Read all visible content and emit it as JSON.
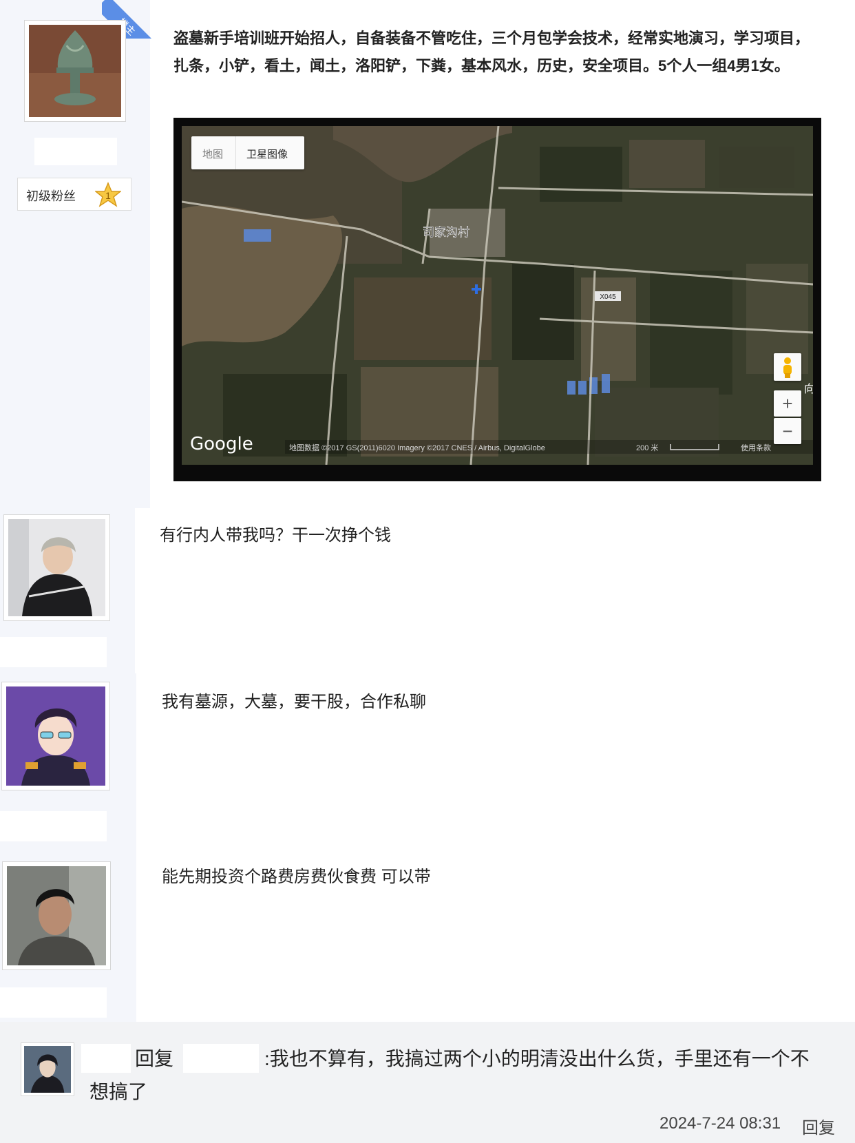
{
  "op_post": {
    "op_tag": "楼主",
    "rank_label": "初级粉丝",
    "rank_level": "1",
    "text": "盗墓新手培训班开始招人，自备装备不管吃住，三个月包学会技术，经常实地演习，学习项目，扎条，小铲，看土，闻土，洛阳铲，下粪，基本风水，历史，安全项目。5个人一组4男1女。",
    "map": {
      "tab_map": "地图",
      "tab_satellite": "卫星图像",
      "village": "司家沟村",
      "road": "X045",
      "zoom_in": "+",
      "zoom_out": "−",
      "side_char": "向",
      "logo": "Google",
      "attribution": "地图数据 ©2017 GS(2011)6020 Imagery ©2017 CNES / Airbus, DigitalGlobe",
      "scale": "200 米",
      "terms": "使用条款"
    }
  },
  "replies": [
    {
      "text": "有行内人带我吗？干一次挣个钱"
    },
    {
      "text": "我有墓源，大墓，要干股，合作私聊"
    },
    {
      "text": "能先期投资个路费房费伙食费 可以带"
    }
  ],
  "sub_reply": {
    "reply_word": "回复",
    "text": ":我也不算有，我搞过两个小的明清没出什么货，手里还有一个不想搞了",
    "timestamp": "2024-7-24 08:31",
    "reply_button": "回复"
  }
}
